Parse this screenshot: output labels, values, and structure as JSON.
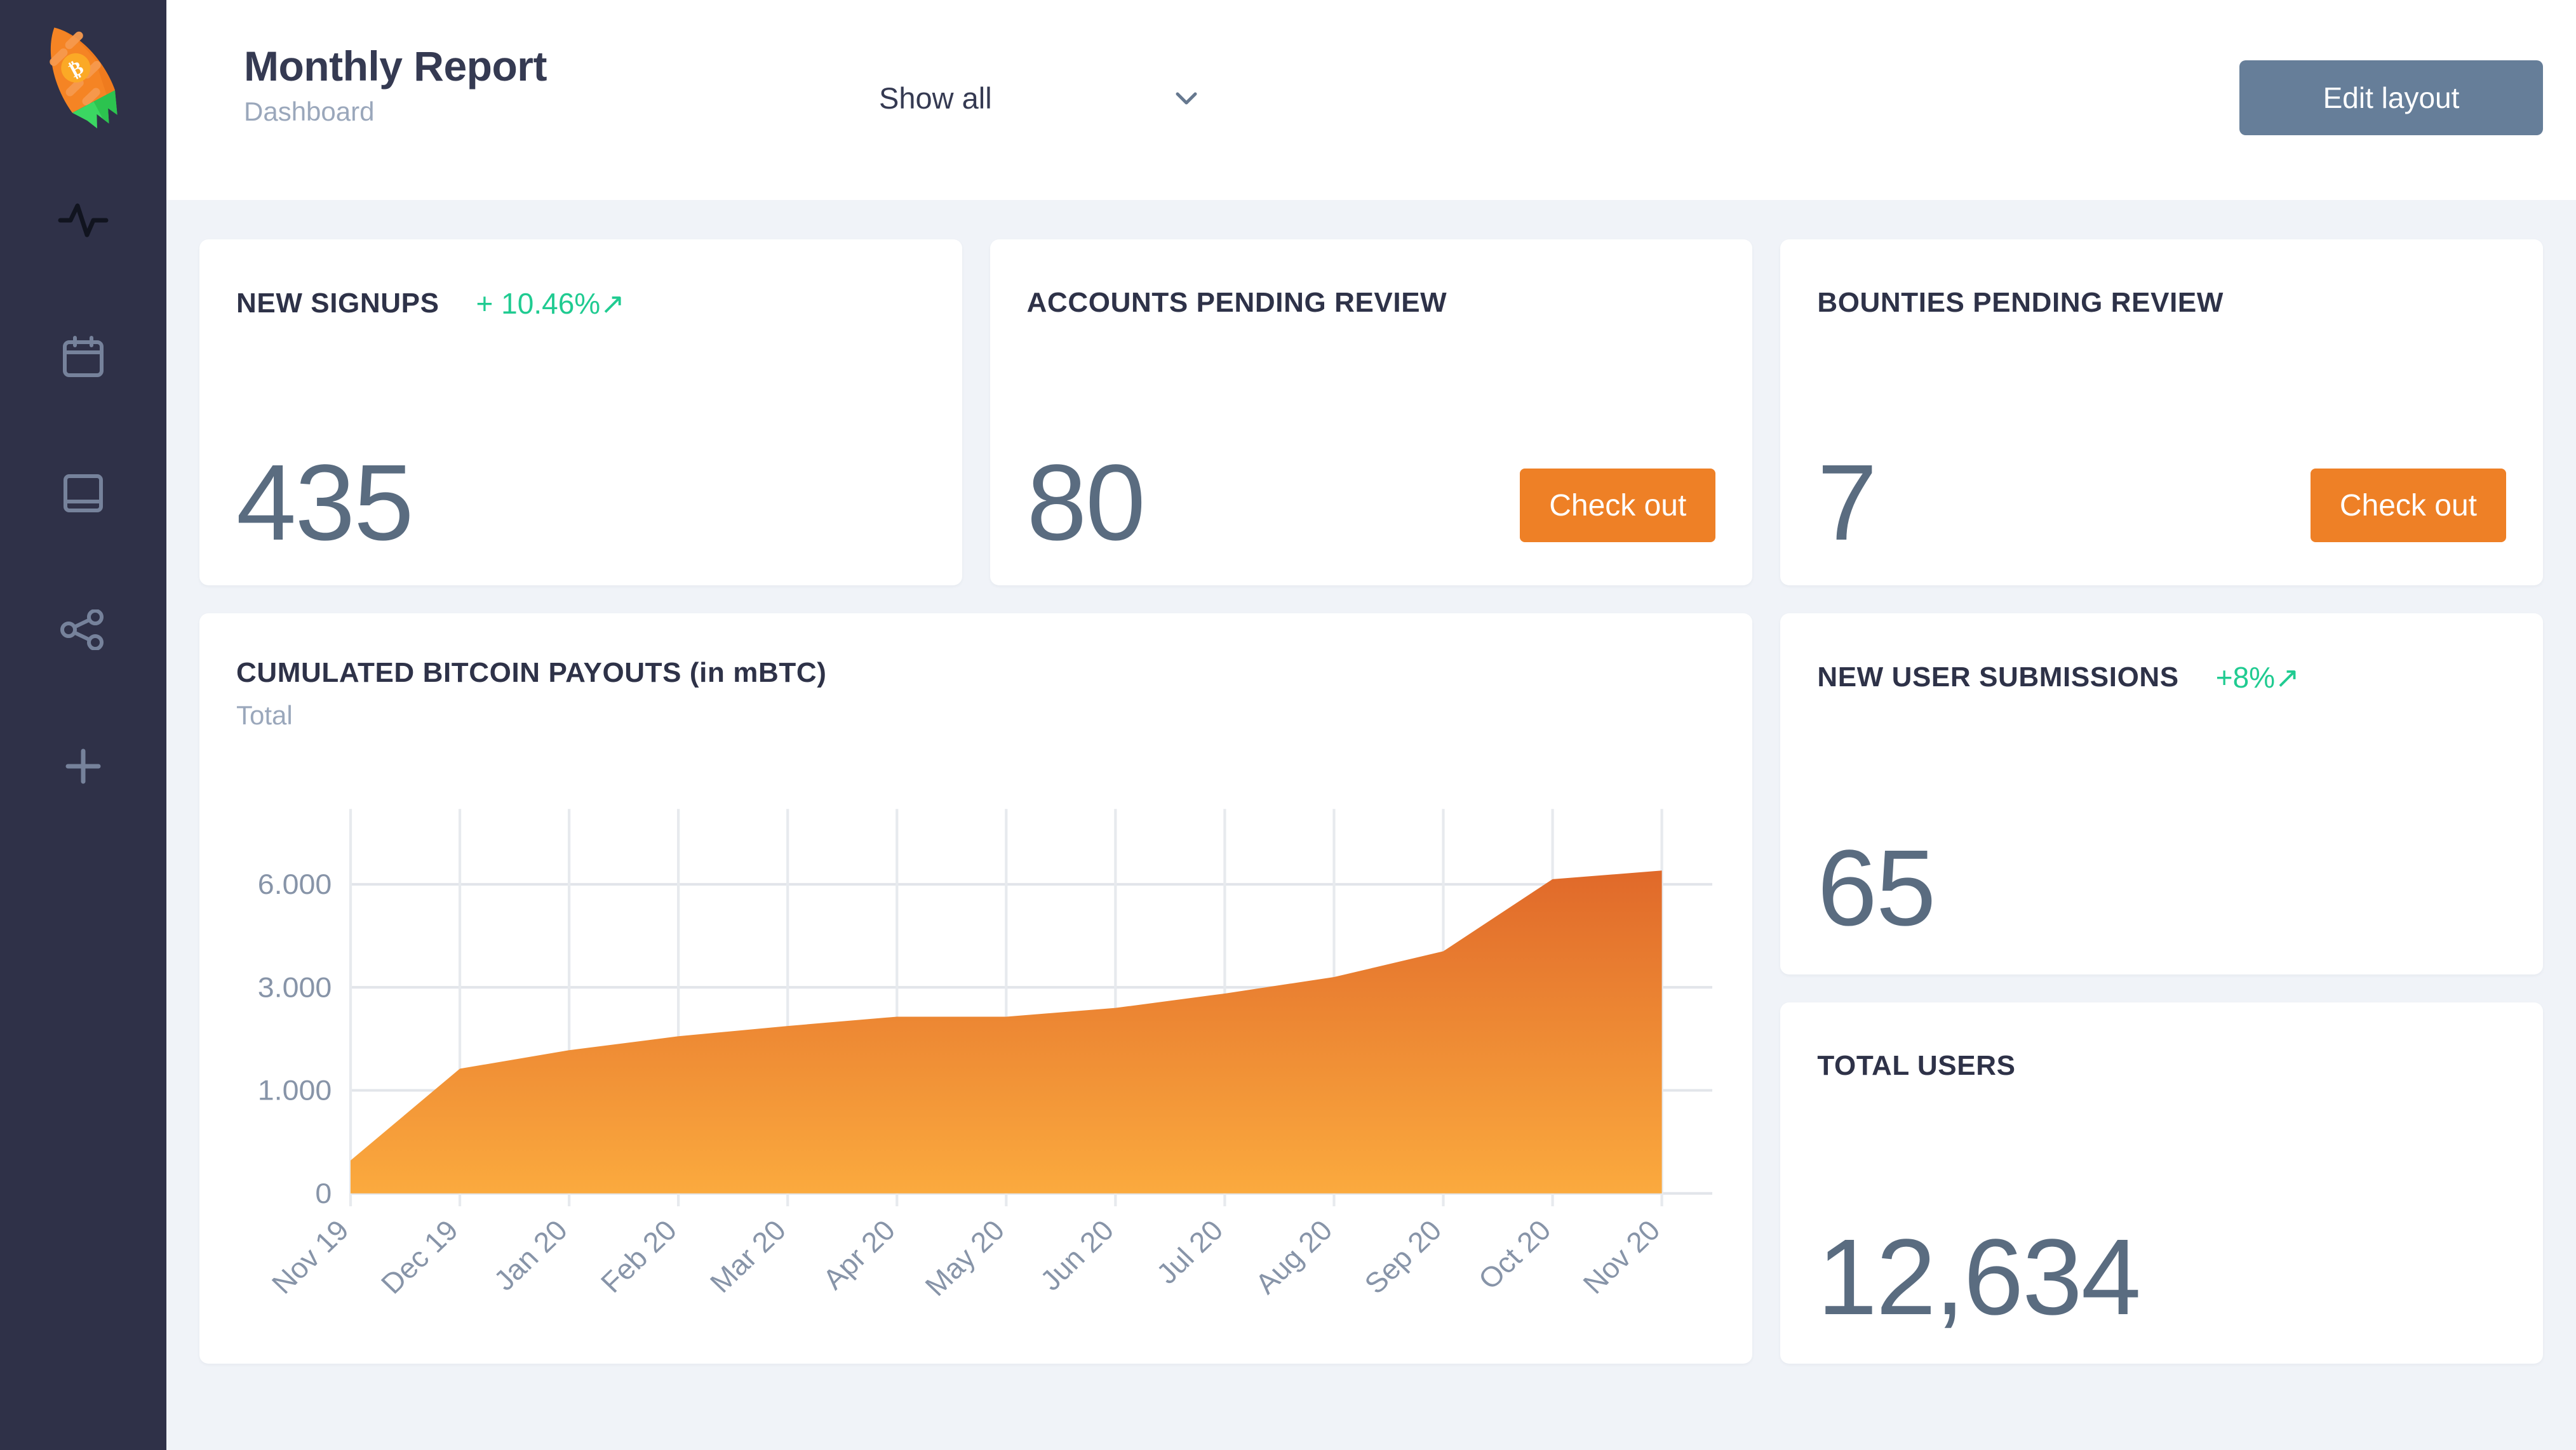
{
  "sidebar": {
    "logo": {
      "name": "carrot-rocket-logo",
      "badge": "bitcoin-badge"
    },
    "items": [
      {
        "icon": "activity-pulse-icon",
        "active": true
      },
      {
        "icon": "calendar-icon",
        "active": false
      },
      {
        "icon": "book-icon",
        "active": false
      },
      {
        "icon": "share-nodes-icon",
        "active": false
      },
      {
        "icon": "plus-icon",
        "active": false
      }
    ],
    "colors": {
      "background": "#2F3148",
      "icon": "#76829B",
      "active_icon": "#11141F"
    }
  },
  "header": {
    "title": "Monthly Report",
    "subtitle": "Dashboard",
    "filter": {
      "value": "Show all",
      "icon": "chevron-down-icon"
    },
    "edit_button": {
      "label": "Edit layout",
      "color": "#667E99"
    }
  },
  "cards": {
    "new_signups": {
      "title": "NEW SIGNUPS",
      "delta": "+ 10.46%↗",
      "delta_color": "#20CB91",
      "value": "435"
    },
    "accounts_pending": {
      "title": "ACCOUNTS PENDING REVIEW",
      "value": "80",
      "button": "Check out"
    },
    "bounties_pending": {
      "title": "BOUNTIES PENDING REVIEW",
      "value": "7",
      "button": "Check out"
    },
    "new_user_submissions": {
      "title": "NEW USER SUBMISSIONS",
      "delta": "+8%↗",
      "delta_color": "#20CB91",
      "value": "65"
    },
    "total_users": {
      "title": "TOTAL USERS",
      "value": "12,634"
    }
  },
  "chart_card": {
    "title": "CUMULATED BITCOIN PAYOUTS (in mBTC)",
    "subtitle": "Total"
  },
  "chart_data": {
    "type": "area",
    "title": "CUMULATED BITCOIN PAYOUTS (in mBTC)",
    "subtitle": "Total",
    "xlabel": "",
    "ylabel": "",
    "grid": true,
    "legend": false,
    "x_tick_rotation": -45,
    "categories": [
      "Nov 19",
      "Dec 19",
      "Jan 20",
      "Feb 20",
      "Mar 20",
      "Apr 20",
      "May 20",
      "Jun 20",
      "Jul 20",
      "Aug 20",
      "Sep 20",
      "Oct 20",
      "Nov 20"
    ],
    "y_ticks": [
      0,
      1000,
      3000,
      6000
    ],
    "y_tick_labels": [
      "0",
      "1.000",
      "3.000",
      "6.000"
    ],
    "ylim": [
      0,
      6500
    ],
    "series": [
      {
        "name": "Total",
        "values": [
          320,
          1420,
          1780,
          2050,
          2250,
          2430,
          2430,
          2600,
          2880,
          3300,
          4050,
          6150,
          6400
        ],
        "fill_gradient": {
          "top": "#E0692A",
          "bottom": "#FBAA3E"
        }
      }
    ]
  }
}
